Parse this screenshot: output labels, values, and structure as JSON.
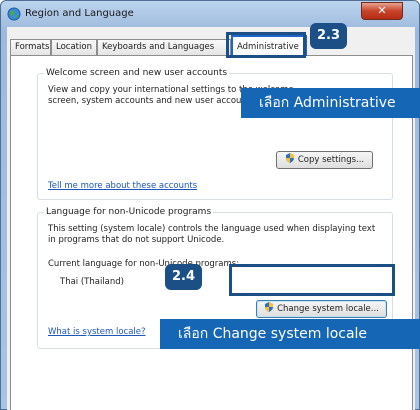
{
  "window": {
    "title": "Region and Language",
    "close_label": "✕"
  },
  "tabs": [
    {
      "label": "Formats"
    },
    {
      "label": "Location"
    },
    {
      "label": "Keyboards and Languages"
    },
    {
      "label": "Administrative"
    }
  ],
  "welcome": {
    "legend": "Welcome screen and new user accounts",
    "description": "View and copy your international settings to the welcome screen, system accounts and new user accounts.",
    "copy_button": "Copy settings...",
    "link": "Tell me more about these accounts"
  },
  "unicode": {
    "legend": "Language for non-Unicode programs",
    "description": "This setting (system locale) controls the language used when displaying text in programs that do not support Unicode.",
    "current_label": "Current language for non-Unicode programs:",
    "current_value": "Thai (Thailand)",
    "change_button": "Change system locale...",
    "link": "What is system locale?"
  },
  "annotations": {
    "badge_1": "2.3",
    "badge_2": "2.4",
    "callout_1": "เลือก Administrative",
    "callout_2": "เลือก Change system locale"
  },
  "colors": {
    "callout": "#1566b5",
    "badge": "#1b4f86",
    "link": "#1b56b8"
  }
}
